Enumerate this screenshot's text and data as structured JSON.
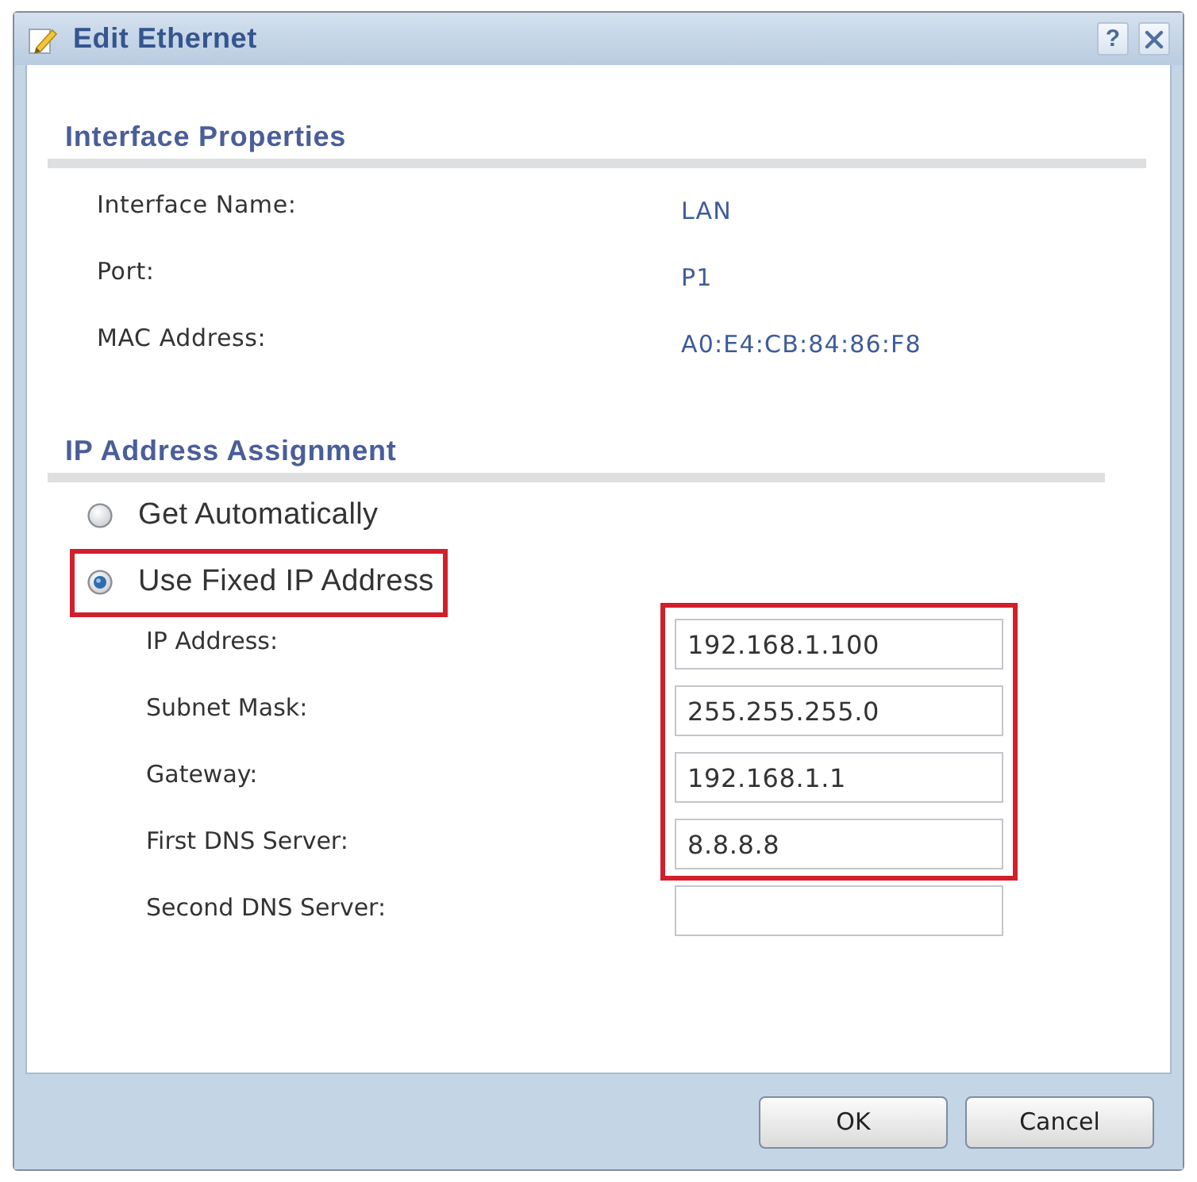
{
  "window": {
    "title": "Edit Ethernet"
  },
  "title_buttons": [
    {
      "kind": "help",
      "label": "?"
    },
    {
      "kind": "close"
    }
  ],
  "sections": [
    {
      "kind": "info",
      "title": "Interface Properties",
      "rows": [
        {
          "label": "Interface Name:",
          "value": "LAN"
        },
        {
          "label": "Port:",
          "value": "P1"
        },
        {
          "label": "MAC Address:",
          "value": "A0:E4:CB:84:86:F8"
        }
      ]
    },
    {
      "kind": "assignment",
      "title": "IP Address Assignment",
      "options": [
        {
          "label": "Get Automatically",
          "selected": false,
          "highlighted": false
        },
        {
          "label": "Use Fixed IP Address",
          "selected": true,
          "highlighted": true
        }
      ],
      "fields": [
        {
          "label": "IP Address:",
          "value": "192.168.1.100",
          "highlighted": true
        },
        {
          "label": "Subnet Mask:",
          "value": "255.255.255.0",
          "highlighted": true
        },
        {
          "label": "Gateway:",
          "value": "192.168.1.1",
          "highlighted": true
        },
        {
          "label": "First DNS Server:",
          "value": "8.8.8.8",
          "highlighted": true
        },
        {
          "label": "Second DNS Server:",
          "highlighted": false
        }
      ]
    }
  ],
  "buttons": [
    {
      "label": "OK"
    },
    {
      "label": "Cancel"
    }
  ]
}
